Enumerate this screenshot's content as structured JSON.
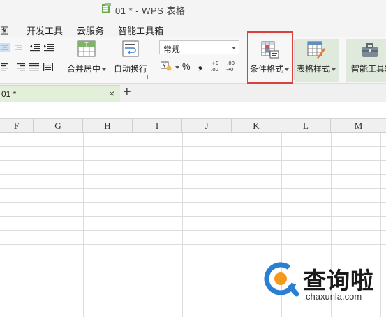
{
  "window": {
    "title": "01 * - WPS 表格"
  },
  "menu": {
    "items": [
      "图",
      "开发工具",
      "云服务",
      "智能工具箱"
    ]
  },
  "ribbon": {
    "merge_center_label": "合并居中",
    "auto_wrap_label": "自动换行",
    "number_format_value": "常规",
    "percent_symbol": "%",
    "comma_symbol": "❟",
    "dec_increase": "+0 .00",
    "dec_decrease": ".00 →0",
    "conditional_format_label": "条件格式",
    "table_style_label": "表格样式",
    "smart_toolbox_label": "智能工具箱"
  },
  "doc_tabs": {
    "active_tab": "01 *",
    "close_symbol": "×",
    "add_symbol": "+"
  },
  "sheet": {
    "columns": [
      "F",
      "G",
      "H",
      "I",
      "J",
      "K",
      "L",
      "M"
    ]
  },
  "watermark": {
    "brand": "查询啦",
    "url": "chaxunla.com"
  },
  "colors": {
    "highlight_border": "#d9423c",
    "active_tab_bg": "#e4efda",
    "ribbon_bg": "#f7f7f7",
    "watermark_blue": "#2a7fd4",
    "watermark_orange": "#f39a1e"
  }
}
